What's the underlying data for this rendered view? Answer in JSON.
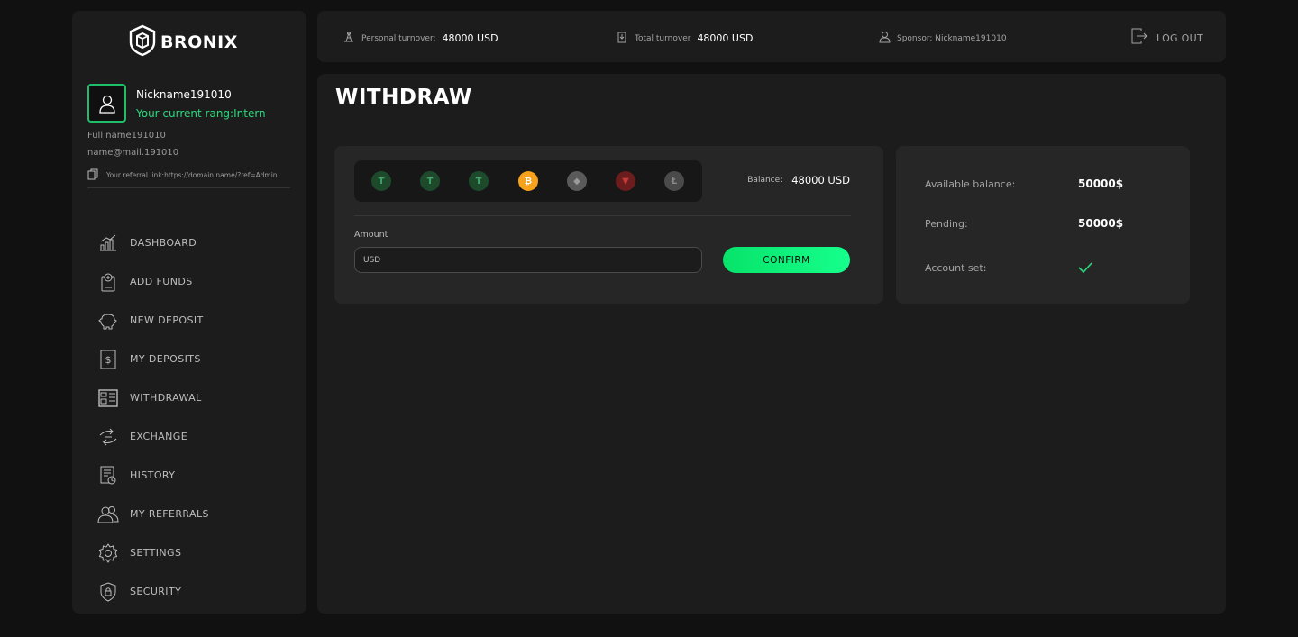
{
  "brand": {
    "name": "BRONIX"
  },
  "profile": {
    "nickname": "Nickname191010",
    "rang": "Your current rang:Intern",
    "full_name": "Full name191010",
    "email": "name@mail.191010",
    "referral": "Your referral link:https://domain.name/?ref=Admin"
  },
  "sidebar": {
    "items": [
      {
        "label": "DASHBOARD",
        "icon": "chart-bars-icon"
      },
      {
        "label": "ADD FUNDS",
        "icon": "add-funds-icon"
      },
      {
        "label": "NEW DEPOSIT",
        "icon": "piggy-bank-icon"
      },
      {
        "label": "MY DEPOSITS",
        "icon": "dollar-doc-icon"
      },
      {
        "label": "WITHDRAWAL",
        "icon": "wallet-icon"
      },
      {
        "label": "EXCHANGE",
        "icon": "exchange-icon"
      },
      {
        "label": "HISTORY",
        "icon": "history-doc-icon"
      },
      {
        "label": "MY REFERRALS",
        "icon": "users-icon"
      },
      {
        "label": "SETTINGS",
        "icon": "gear-icon"
      },
      {
        "label": "SECURITY",
        "icon": "shield-lock-icon"
      }
    ]
  },
  "topbar": {
    "personal_turnover_label": "Personal turnover:",
    "personal_turnover_value": "48000 USD",
    "total_turnover_label": "Total turnover",
    "total_turnover_value": "48000 USD",
    "sponsor": "Sponsor:  Nickname191010",
    "logout": "LOG OUT"
  },
  "page": {
    "title": "WITHDRAW"
  },
  "withdraw": {
    "coins": [
      {
        "symbol": "tether",
        "color": "#1e4a2c",
        "glyph": "T",
        "glyph_color": "#3fa36a"
      },
      {
        "symbol": "tether-trc",
        "color": "#1e4a2c",
        "glyph": "T",
        "glyph_color": "#3fa36a"
      },
      {
        "symbol": "tether-bep",
        "color": "#1e4a2c",
        "glyph": "T",
        "glyph_color": "#3fa36a"
      },
      {
        "symbol": "bitcoin",
        "color": "#f7a21b",
        "glyph": "₿",
        "glyph_color": "#ffffff"
      },
      {
        "symbol": "ethereum",
        "color": "#5a5a5a",
        "glyph": "◆",
        "glyph_color": "#9a9a9a"
      },
      {
        "symbol": "tron",
        "color": "#6b1c1c",
        "glyph": "▼",
        "glyph_color": "#c23a3a"
      },
      {
        "symbol": "litecoin",
        "color": "#4a4a4a",
        "glyph": "Ł",
        "glyph_color": "#8a8a8a"
      }
    ],
    "balance_label": "Balance:",
    "balance_value": "48000 USD",
    "amount_label": "Amount",
    "amount_placeholder": "USD",
    "confirm_label": "CONFIRM"
  },
  "summary": {
    "available_label": "Available balance:",
    "available_value": "50000$",
    "pending_label": "Pending:",
    "pending_value": "50000$",
    "account_set_label": "Account set:",
    "account_set_icon": "check-icon",
    "accent_color": "#2bd97d"
  }
}
